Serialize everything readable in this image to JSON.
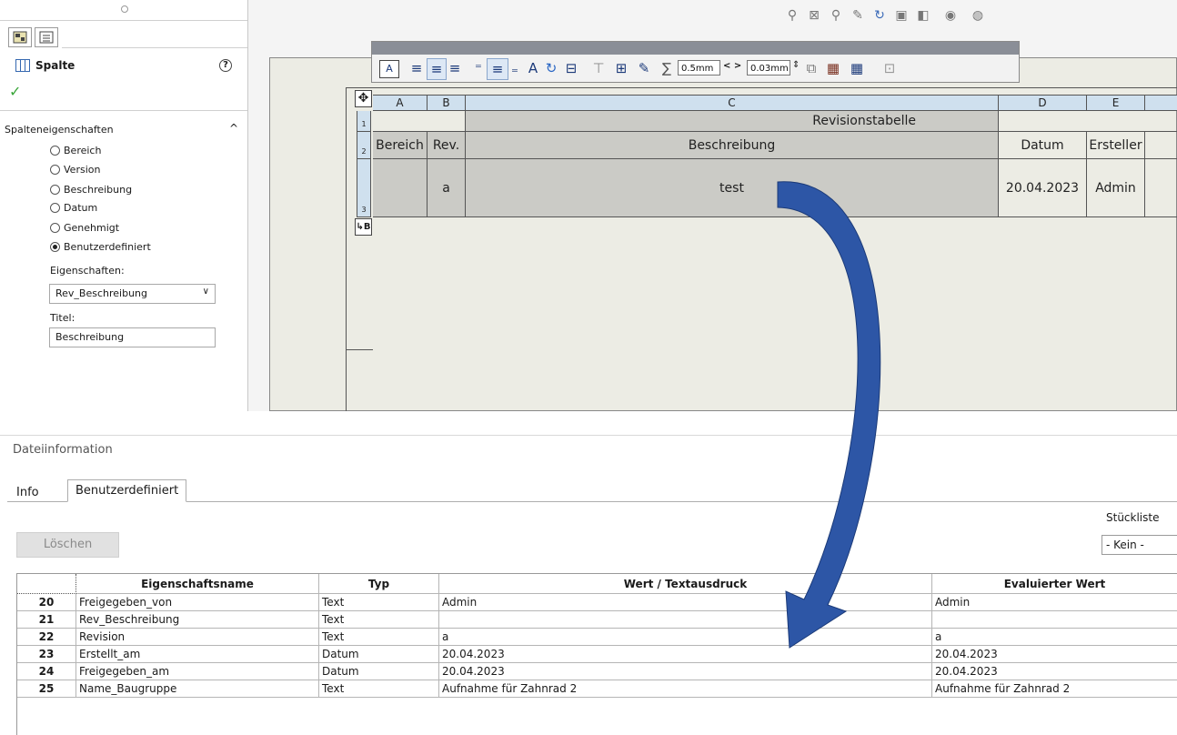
{
  "property_manager": {
    "title": "Spalte",
    "help_icon": "help-icon",
    "ok_icon": "checkmark-icon",
    "section_title": "Spalteneigenschaften",
    "options": [
      {
        "label": "Bereich",
        "selected": false
      },
      {
        "label": "Version",
        "selected": false
      },
      {
        "label": "Beschreibung",
        "selected": false
      },
      {
        "label": "Datum",
        "selected": false
      },
      {
        "label": "Genehmigt",
        "selected": false
      },
      {
        "label": "Benutzerdefiniert",
        "selected": true
      }
    ],
    "properties_label": "Eigenschaften:",
    "properties_value": "Rev_Beschreibung",
    "title_label": "Titel:",
    "title_value": "Beschreibung"
  },
  "format_toolbar": {
    "field_1": "0.5mm",
    "field_2": "0.03mm",
    "spacer_symbol": "< >"
  },
  "revision_table": {
    "columns": [
      "A",
      "B",
      "C",
      "D",
      "E"
    ],
    "title": "Revisionstabelle",
    "headers": [
      "Bereich",
      "Rev.",
      "Beschreibung",
      "Datum",
      "Ersteller"
    ],
    "row": [
      "",
      "a",
      "test",
      "20.04.2023",
      "Admin"
    ],
    "row_numbers": [
      "1",
      "2",
      "3"
    ],
    "anchor_label": "↳B"
  },
  "dialog": {
    "title": "Dateiinformation",
    "tabs": [
      "Info",
      "Benutzerdefiniert"
    ],
    "active_tab": "Benutzerdefiniert",
    "delete_button": "Löschen",
    "bom_label": "Stückliste",
    "bom_value": "- Kein -",
    "grid_headers": [
      "Eigenschaftsname",
      "Typ",
      "Wert / Textausdruck",
      "Evaluierter Wert"
    ],
    "grid_rows": [
      {
        "n": "20",
        "name": "Freigegeben_von",
        "type": "Text",
        "value": "Admin",
        "eval": "Admin"
      },
      {
        "n": "21",
        "name": "Rev_Beschreibung",
        "type": "Text",
        "value": "",
        "eval": ""
      },
      {
        "n": "22",
        "name": "Revision",
        "type": "Text",
        "value": "a",
        "eval": "a"
      },
      {
        "n": "23",
        "name": "Erstellt_am",
        "type": "Datum",
        "value": "20.04.2023",
        "eval": "20.04.2023"
      },
      {
        "n": "24",
        "name": "Freigegeben_am",
        "type": "Datum",
        "value": "20.04.2023",
        "eval": "20.04.2023"
      },
      {
        "n": "25",
        "name": "Name_Baugruppe",
        "type": "Text",
        "value": "Aufnahme für Zahnrad 2",
        "eval": "Aufnahme für Zahnrad 2"
      }
    ]
  },
  "annotation": {
    "arrow_color": "#2d56a6"
  }
}
